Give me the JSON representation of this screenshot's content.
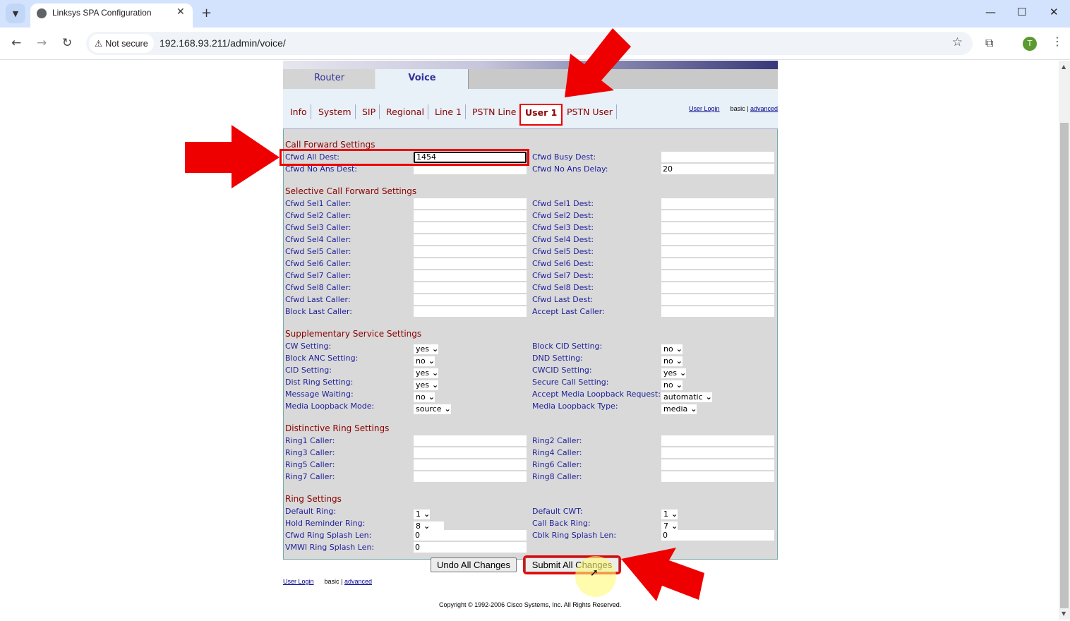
{
  "browser": {
    "tab_title": "Linksys SPA Configuration",
    "security_label": "Not secure",
    "url": "192.168.93.211/admin/voice/",
    "profile_initial": "T"
  },
  "page": {
    "main_tabs": [
      {
        "label": "Router",
        "active": false
      },
      {
        "label": "Voice",
        "active": true
      }
    ],
    "sub_tabs": [
      {
        "label": "Info"
      },
      {
        "label": "System"
      },
      {
        "label": "SIP"
      },
      {
        "label": "Regional"
      },
      {
        "label": "Line 1"
      },
      {
        "label": "PSTN Line"
      },
      {
        "label": "User 1",
        "active": true
      },
      {
        "label": "PSTN User"
      }
    ],
    "links": {
      "user_login": "User Login",
      "basic": "basic",
      "separator": "|",
      "advanced": "advanced"
    },
    "sections": {
      "call_forward": {
        "title": "Call Forward Settings",
        "rows": [
          {
            "left_label": "Cfwd All Dest:",
            "left_value": "1454",
            "right_label": "Cfwd Busy Dest:",
            "right_value": ""
          },
          {
            "left_label": "Cfwd No Ans Dest:",
            "left_value": "",
            "right_label": "Cfwd No Ans Delay:",
            "right_value": "20"
          }
        ]
      },
      "selective": {
        "title": "Selective Call Forward Settings",
        "rows": [
          {
            "left_label": "Cfwd Sel1 Caller:",
            "left_value": "",
            "right_label": "Cfwd Sel1 Dest:",
            "right_value": ""
          },
          {
            "left_label": "Cfwd Sel2 Caller:",
            "left_value": "",
            "right_label": "Cfwd Sel2 Dest:",
            "right_value": ""
          },
          {
            "left_label": "Cfwd Sel3 Caller:",
            "left_value": "",
            "right_label": "Cfwd Sel3 Dest:",
            "right_value": ""
          },
          {
            "left_label": "Cfwd Sel4 Caller:",
            "left_value": "",
            "right_label": "Cfwd Sel4 Dest:",
            "right_value": ""
          },
          {
            "left_label": "Cfwd Sel5 Caller:",
            "left_value": "",
            "right_label": "Cfwd Sel5 Dest:",
            "right_value": ""
          },
          {
            "left_label": "Cfwd Sel6 Caller:",
            "left_value": "",
            "right_label": "Cfwd Sel6 Dest:",
            "right_value": ""
          },
          {
            "left_label": "Cfwd Sel7 Caller:",
            "left_value": "",
            "right_label": "Cfwd Sel7 Dest:",
            "right_value": ""
          },
          {
            "left_label": "Cfwd Sel8 Caller:",
            "left_value": "",
            "right_label": "Cfwd Sel8 Dest:",
            "right_value": ""
          },
          {
            "left_label": "Cfwd Last Caller:",
            "left_value": "",
            "right_label": "Cfwd Last Dest:",
            "right_value": ""
          },
          {
            "left_label": "Block Last Caller:",
            "left_value": "",
            "right_label": "Accept Last Caller:",
            "right_value": ""
          }
        ]
      },
      "supplementary": {
        "title": "Supplementary Service Settings",
        "rows": [
          {
            "left_label": "CW Setting:",
            "left_select": "yes",
            "right_label": "Block CID Setting:",
            "right_select": "no"
          },
          {
            "left_label": "Block ANC Setting:",
            "left_select": "no",
            "right_label": "DND Setting:",
            "right_select": "no"
          },
          {
            "left_label": "CID Setting:",
            "left_select": "yes",
            "right_label": "CWCID Setting:",
            "right_select": "yes"
          },
          {
            "left_label": "Dist Ring Setting:",
            "left_select": "yes",
            "right_label": "Secure Call Setting:",
            "right_select": "no"
          },
          {
            "left_label": "Message Waiting:",
            "left_select": "no",
            "right_label": "Accept Media Loopback Request:",
            "right_select": "automatic"
          },
          {
            "left_label": "Media Loopback Mode:",
            "left_select": "source",
            "right_label": "Media Loopback Type:",
            "right_select": "media"
          }
        ]
      },
      "distinctive": {
        "title": "Distinctive Ring Settings",
        "rows": [
          {
            "left_label": "Ring1 Caller:",
            "left_value": "",
            "right_label": "Ring2 Caller:",
            "right_value": ""
          },
          {
            "left_label": "Ring3 Caller:",
            "left_value": "",
            "right_label": "Ring4 Caller:",
            "right_value": ""
          },
          {
            "left_label": "Ring5 Caller:",
            "left_value": "",
            "right_label": "Ring6 Caller:",
            "right_value": ""
          },
          {
            "left_label": "Ring7 Caller:",
            "left_value": "",
            "right_label": "Ring8 Caller:",
            "right_value": ""
          }
        ]
      },
      "ring": {
        "title": "Ring Settings",
        "rows": [
          {
            "left_label": "Default Ring:",
            "left_select": "1",
            "right_label": "Default CWT:",
            "right_select": "1"
          },
          {
            "left_label": "Hold Reminder Ring:",
            "left_select": "8",
            "right_label": "Call Back Ring:",
            "right_select": "7"
          },
          {
            "left_label": "Cfwd Ring Splash Len:",
            "left_value": "0",
            "right_label": "Cblk Ring Splash Len:",
            "right_value": "0"
          },
          {
            "left_label": "VMWI Ring Splash Len:",
            "left_value": "0"
          }
        ]
      }
    },
    "buttons": {
      "undo": "Undo All Changes",
      "submit": "Submit All Changes"
    },
    "copyright": "Copyright © 1992-2006 Cisco Systems, Inc. All Rights Reserved."
  },
  "annotation_color": "#ee0000"
}
